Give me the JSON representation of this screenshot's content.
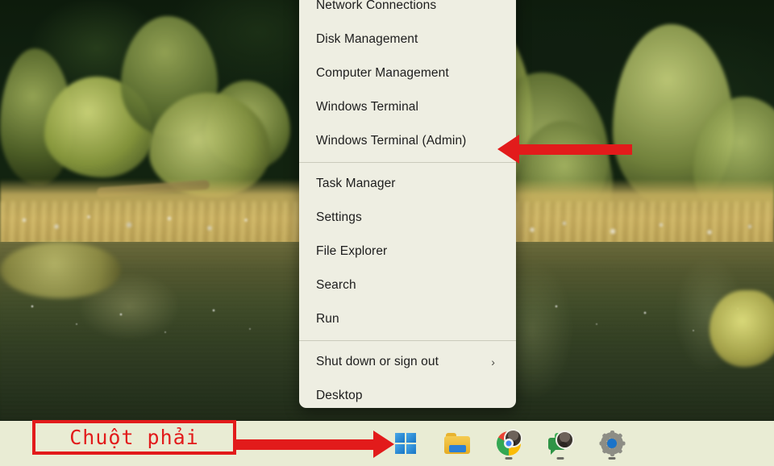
{
  "desktop": {
    "wallpaper_description": "River and forest landscape wallpaper"
  },
  "context_menu": {
    "name": "Win+X Quick Link menu",
    "background_color": "#eeeee2",
    "items": [
      {
        "label": "Network Connections",
        "has_submenu": false
      },
      {
        "label": "Disk Management",
        "has_submenu": false
      },
      {
        "label": "Computer Management",
        "has_submenu": false
      },
      {
        "label": "Windows Terminal",
        "has_submenu": false
      },
      {
        "label": "Windows Terminal (Admin)",
        "has_submenu": false
      },
      {
        "label": "Task Manager",
        "has_submenu": false
      },
      {
        "label": "Settings",
        "has_submenu": false
      },
      {
        "label": "File Explorer",
        "has_submenu": false
      },
      {
        "label": "Search",
        "has_submenu": false
      },
      {
        "label": "Run",
        "has_submenu": false
      },
      {
        "label": "Shut down or sign out",
        "has_submenu": true,
        "submenu_glyph": "›"
      },
      {
        "label": "Desktop",
        "has_submenu": false
      }
    ]
  },
  "taskbar": {
    "background_color": "#e9ecd4",
    "icons": [
      {
        "name": "start-button",
        "icon": "windows-logo-icon",
        "running": false
      },
      {
        "name": "file-explorer-button",
        "icon": "folder-icon",
        "running": false
      },
      {
        "name": "google-chrome-button",
        "icon": "chrome-icon",
        "running": true,
        "badge": "user-avatar"
      },
      {
        "name": "messaging-button",
        "icon": "message-bubble-icon",
        "running": true,
        "badge": "user-avatar"
      },
      {
        "name": "settings-button",
        "icon": "gear-icon",
        "running": true
      }
    ]
  },
  "annotations": {
    "accent_color": "#e21b1b",
    "callout_text": "Chuột phải",
    "arrow_to_start": "arrow-pointing-right-to-start-button",
    "arrow_to_menu_item": "arrow-pointing-left-to-windows-terminal-admin"
  }
}
